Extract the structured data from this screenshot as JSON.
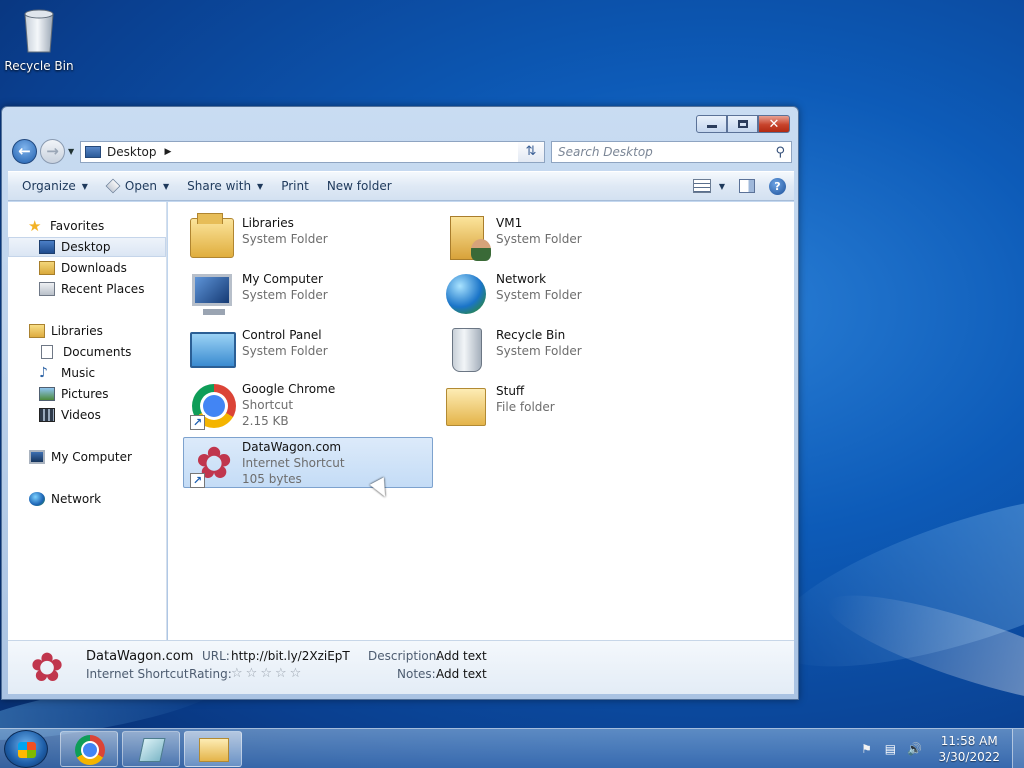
{
  "desktop": {
    "recycle_bin_label": "Recycle Bin"
  },
  "window": {
    "address": "Desktop",
    "search_placeholder": "Search Desktop",
    "close_glyph": "✕"
  },
  "toolbar": {
    "organize": "Organize",
    "open": "Open",
    "share_with": "Share with",
    "print": "Print",
    "new_folder": "New folder",
    "help": "?"
  },
  "nav": {
    "favorites": "Favorites",
    "desktop": "Desktop",
    "downloads": "Downloads",
    "recent_places": "Recent Places",
    "libraries": "Libraries",
    "documents": "Documents",
    "music": "Music",
    "pictures": "Pictures",
    "videos": "Videos",
    "my_computer": "My Computer",
    "network": "Network"
  },
  "items": [
    {
      "name": "Libraries",
      "type": "System Folder",
      "size": "",
      "icon": "libraries-icon"
    },
    {
      "name": "VM1",
      "type": "System Folder",
      "size": "",
      "icon": "user-folder-icon"
    },
    {
      "name": "My Computer",
      "type": "System Folder",
      "size": "",
      "icon": "computer-icon"
    },
    {
      "name": "Network",
      "type": "System Folder",
      "size": "",
      "icon": "network-icon"
    },
    {
      "name": "Control Panel",
      "type": "System Folder",
      "size": "",
      "icon": "control-panel-icon"
    },
    {
      "name": "Recycle Bin",
      "type": "System Folder",
      "size": "",
      "icon": "recycle-bin-icon"
    },
    {
      "name": "Google Chrome",
      "type": "Shortcut",
      "size": "2.15 KB",
      "icon": "chrome-icon"
    },
    {
      "name": "Stuff",
      "type": "File folder",
      "size": "",
      "icon": "folder-icon"
    },
    {
      "name": "DataWagon.com",
      "type": "Internet Shortcut",
      "size": "105 bytes",
      "icon": "datawagon-icon",
      "selected": true
    }
  ],
  "details": {
    "name": "DataWagon.com",
    "type": "Internet Shortcut",
    "url_label": "URL:",
    "url_value": "http://bit.ly/2XziEpT",
    "rating_label": "Rating:",
    "rating_value": 0,
    "rating_max": 5,
    "description_label": "Description:",
    "description_value": "Add text",
    "notes_label": "Notes:",
    "notes_value": "Add text"
  },
  "taskbar": {
    "time": "11:58 AM",
    "date": "3/30/2022"
  }
}
